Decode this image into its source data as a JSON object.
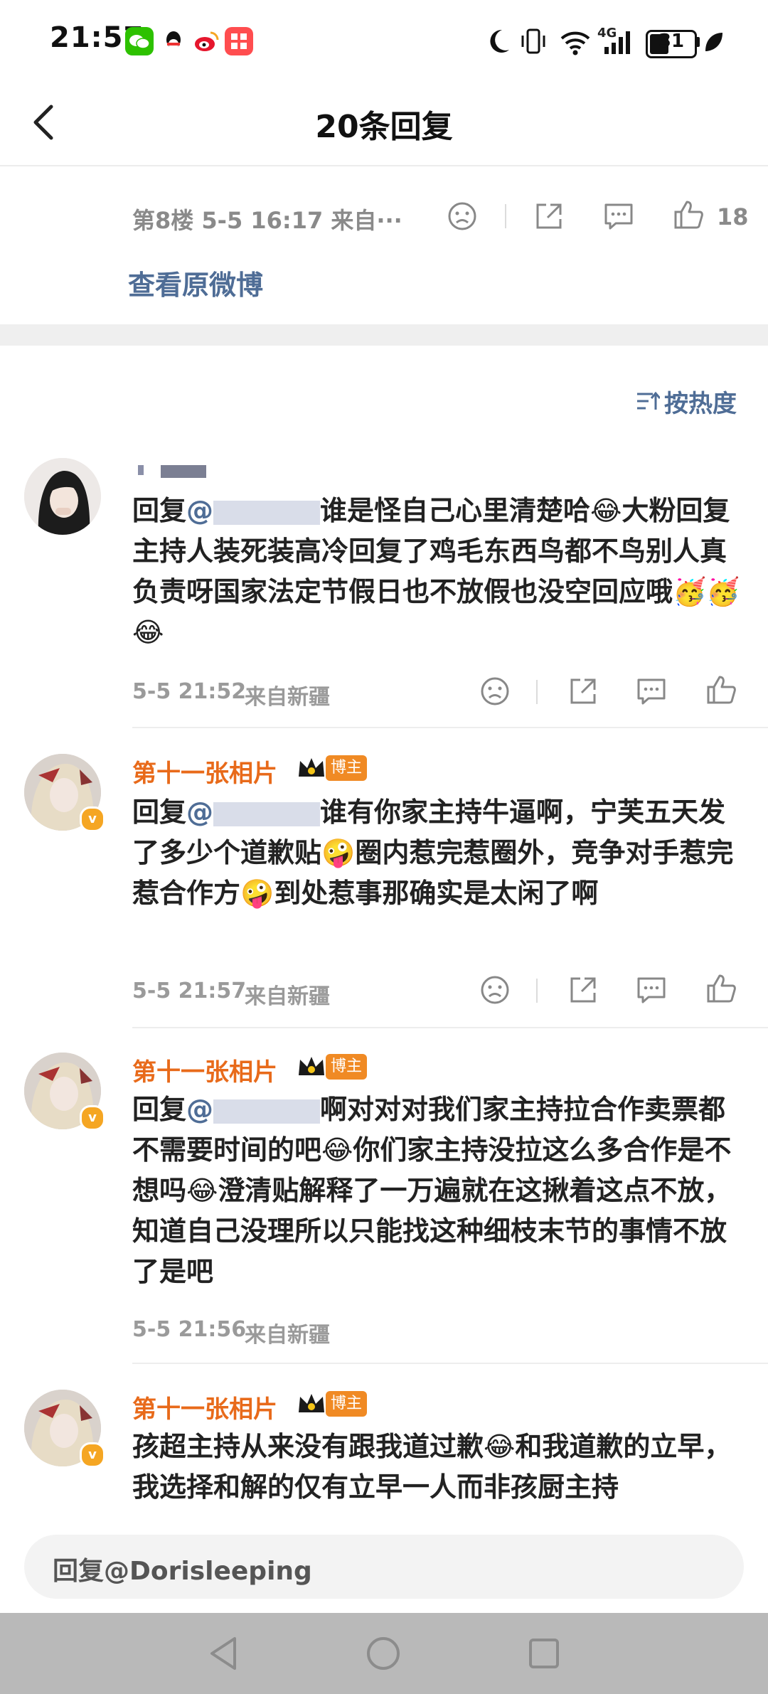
{
  "status_bar": {
    "time": "21:57",
    "network": "4G",
    "battery": "31",
    "apps": [
      "wechat-icon",
      "qq-icon",
      "weibo-icon",
      "app-icon"
    ]
  },
  "header": {
    "title": "20条回复"
  },
  "floor": {
    "meta": "第8楼 5-5 16:17 来自···",
    "like_count": "18",
    "view_original": "查看原微博"
  },
  "sort": {
    "label": "按热度"
  },
  "comments": [
    {
      "author": "",
      "reply_prefix": "回复",
      "text": "谁是怪自己心里清楚哈😂大粉回复主持人装死装高冷回复了鸡毛东西鸟都不鸟别人真负责呀国家法定节假日也不放假也没空回应哦🥳🥳😂",
      "time": "5-5 21:52",
      "source": "来自新疆"
    },
    {
      "author": "第十一张相片",
      "badge": "博主",
      "reply_prefix": "回复",
      "text": "谁有你家主持牛逼啊，宁芙五天发了多少个道歉贴🤪圈内惹完惹圈外，竞争对手惹完惹合作方🤪到处惹事那确实是太闲了啊",
      "time": "5-5 21:57",
      "source": "来自新疆"
    },
    {
      "author": "第十一张相片",
      "badge": "博主",
      "reply_prefix": "回复",
      "text": "啊对对对我们家主持拉合作卖票都不需要时间的吧😂你们家主持没拉这么多合作是不想吗😂澄清贴解释了一万遍就在这揪着这点不放，知道自己没理所以只能找这种细枝末节的事情不放了是吧",
      "time": "5-5 21:56",
      "source": "来自新疆"
    },
    {
      "author": "第十一张相片",
      "badge": "博主",
      "text": "孩超主持从来没有跟我道过歉😂和我道歉的立早，我选择和解的仅有立早一人而非孩厨主持"
    }
  ],
  "reply_input": {
    "placeholder": "回复@Dorisleeping"
  }
}
